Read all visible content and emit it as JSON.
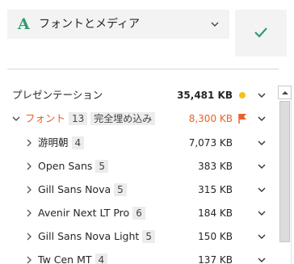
{
  "header": {
    "dropdown": {
      "icon_glyph": "A",
      "icon_color": "#2f9e6e",
      "label": "フォントとメディア"
    },
    "confirm_icon": "checkmark-icon",
    "confirm_color": "#2f9e6e"
  },
  "presentation": {
    "label": "プレゼンテーション",
    "size": "35,481 KB",
    "status_color": "#f2c21b"
  },
  "fonts": {
    "label": "フォント",
    "count": "13",
    "tag": "完全埋め込み",
    "size": "8,300 KB",
    "accent_color": "#e8622a"
  },
  "font_items": [
    {
      "name": "游明朝",
      "count": "4",
      "size": "7,073 KB"
    },
    {
      "name": "Open Sans",
      "count": "5",
      "size": "383 KB"
    },
    {
      "name": "Gill Sans Nova",
      "count": "5",
      "size": "315 KB"
    },
    {
      "name": "Avenir Next LT Pro",
      "count": "6",
      "size": "184 KB"
    },
    {
      "name": "Gill Sans Nova Light",
      "count": "5",
      "size": "150 KB"
    },
    {
      "name": "Tw Cen MT",
      "count": "4",
      "size": "137 KB"
    }
  ]
}
